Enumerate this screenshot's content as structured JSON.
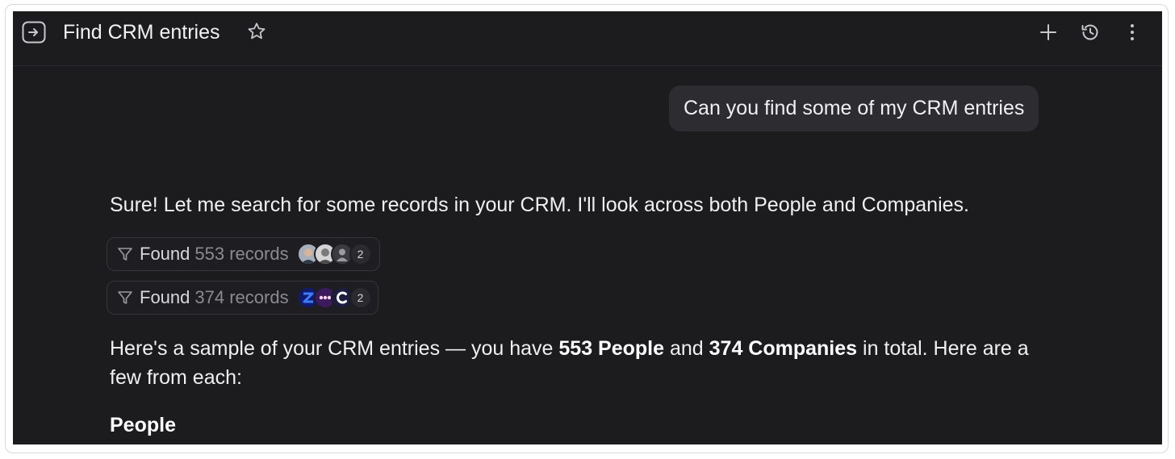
{
  "header": {
    "title": "Find CRM entries",
    "icons": {
      "panel": "panel-toggle-icon",
      "favorite": "star-icon",
      "new_chat": "plus-icon",
      "history": "history-icon",
      "more": "more-vertical-icon"
    }
  },
  "conversation": {
    "user_message": "Can you find some of my CRM entries",
    "assistant_intro": "Sure! Let me search for some records in your CRM. I'll look across both People and Companies.",
    "tool_results": [
      {
        "found_label": "Found",
        "count_label": "553 records",
        "avatars": [
          "person-avatar",
          "person-avatar",
          "default-person-avatar"
        ],
        "more_count": "2"
      },
      {
        "found_label": "Found",
        "count_label": "374 records",
        "avatars": [
          "company-logo",
          "company-logo",
          "company-logo"
        ],
        "more_count": "2"
      }
    ],
    "summary": {
      "part1": "Here's a sample of your CRM entries — you have ",
      "people_total": "553 People",
      "part2": " and ",
      "companies_total": "374 Companies",
      "part3": " in total. Here are a few from each:"
    },
    "section_heading": "People"
  },
  "colors": {
    "background": "#1c1c1f",
    "bubble": "#2c2c31",
    "text": "#f0f0f2",
    "muted": "#8a8a92",
    "pill_border": "#35353a"
  }
}
